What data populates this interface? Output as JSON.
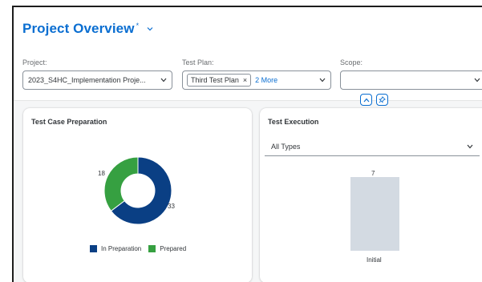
{
  "header": {
    "title": "Project Overview",
    "title_marker": "*"
  },
  "filters": {
    "project": {
      "label": "Project:",
      "value": "2023_S4HC_Implementation Proje..."
    },
    "test_plan": {
      "label": "Test Plan:",
      "token": "Third Test Plan",
      "more": "2 More"
    },
    "scope": {
      "label": "Scope:",
      "value": ""
    }
  },
  "cards": {
    "preparation": {
      "title": "Test Case Preparation",
      "legend": [
        {
          "label": "In Preparation",
          "color": "#0a3f84"
        },
        {
          "label": "Prepared",
          "color": "#36a041"
        }
      ]
    },
    "execution": {
      "title": "Test Execution",
      "filter_value": "All Types"
    }
  },
  "chart_data": [
    {
      "type": "pie",
      "donut": true,
      "title": "Test Case Preparation",
      "categories": [
        "In Preparation",
        "Prepared"
      ],
      "values": [
        33,
        18
      ],
      "colors": [
        "#0a3f84",
        "#36a041"
      ],
      "legend": "bottom"
    },
    {
      "type": "bar",
      "title": "Test Execution",
      "categories": [
        "Initial"
      ],
      "values": [
        7
      ],
      "color": "#d3dae2",
      "grid": false
    }
  ]
}
